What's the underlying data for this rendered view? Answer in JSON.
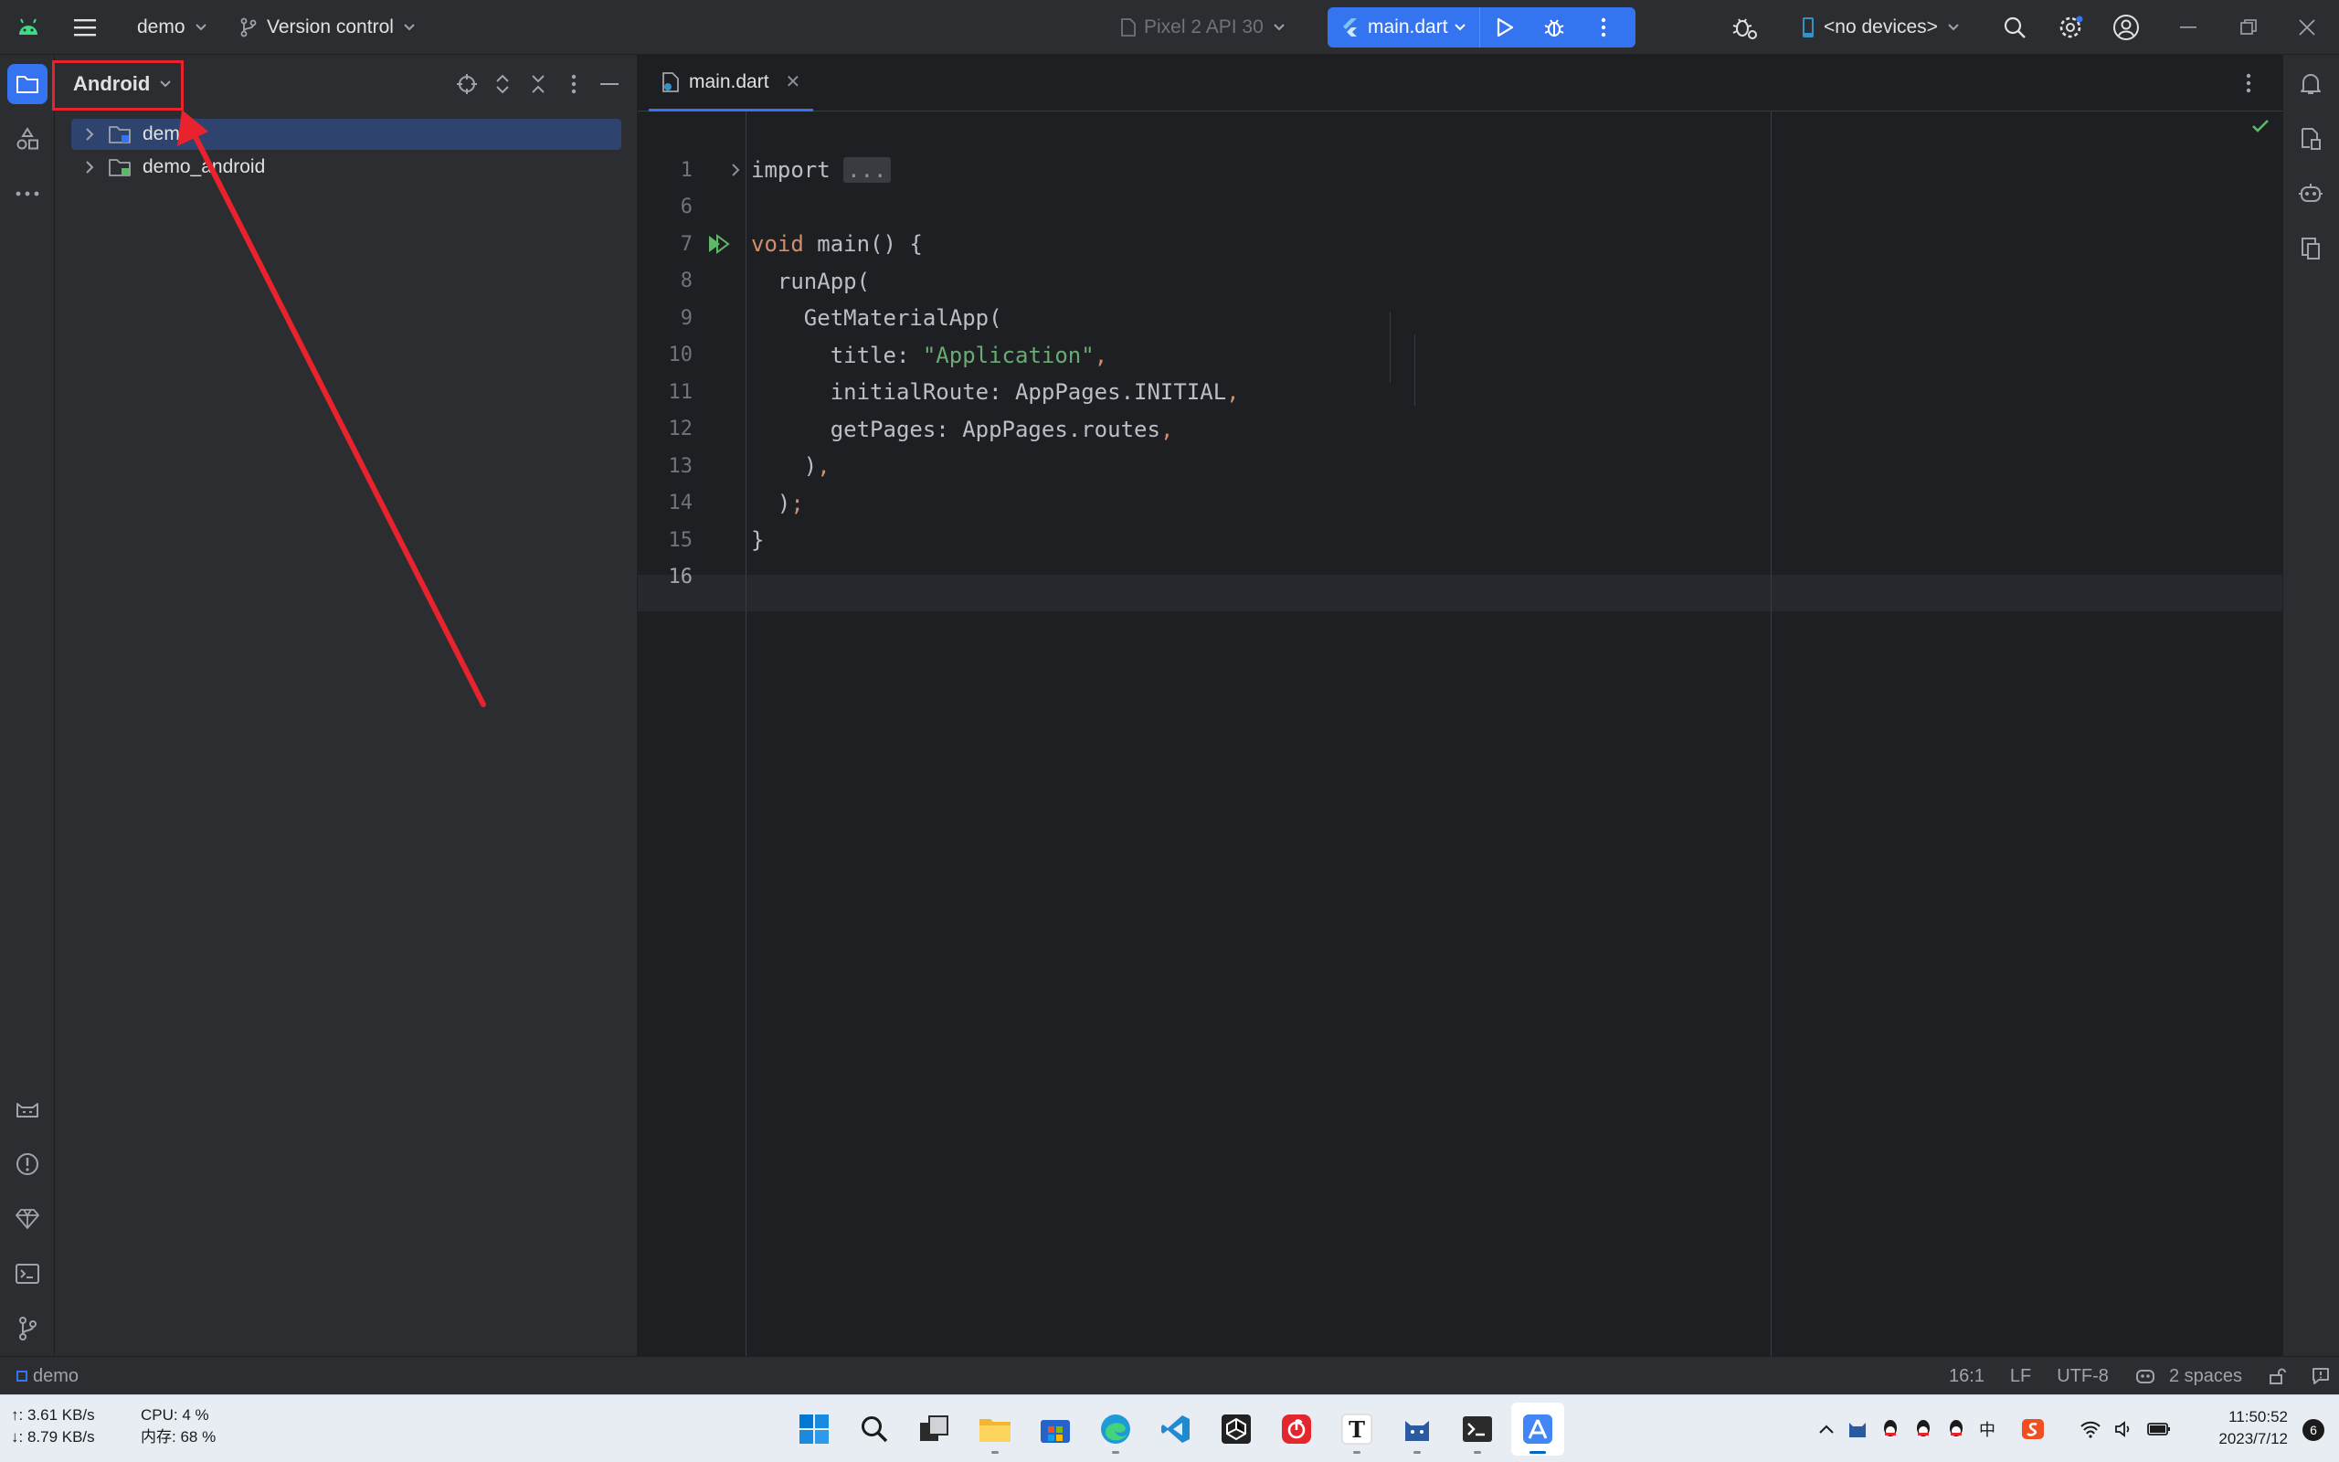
{
  "titlebar": {
    "project_name": "demo",
    "vcs_label": "Version control",
    "device_label": "Pixel 2 API 30",
    "run_config": "main.dart",
    "devices_label": "<no devices>"
  },
  "project_panel": {
    "view_mode": "Android",
    "tree": [
      {
        "label": "demo",
        "selected": true
      },
      {
        "label": "demo_android",
        "selected": false
      }
    ]
  },
  "editor": {
    "tab_label": "main.dart",
    "lines": [
      {
        "num": "1",
        "parts": [
          [
            "kw_plain",
            "import "
          ],
          [
            "fold",
            "..."
          ]
        ]
      },
      {
        "num": "6",
        "parts": []
      },
      {
        "num": "7",
        "parts": [
          [
            "kw",
            "void "
          ],
          [
            "plain",
            "main() {"
          ]
        ]
      },
      {
        "num": "8",
        "parts": [
          [
            "plain",
            "  runApp("
          ]
        ]
      },
      {
        "num": "9",
        "parts": [
          [
            "plain",
            "    GetMaterialApp("
          ]
        ]
      },
      {
        "num": "10",
        "parts": [
          [
            "plain",
            "      title: "
          ],
          [
            "str",
            "\"Application\""
          ],
          [
            "kw",
            ","
          ]
        ]
      },
      {
        "num": "11",
        "parts": [
          [
            "plain",
            "      initialRoute: AppPages.INITIAL"
          ],
          [
            "kw",
            ","
          ]
        ]
      },
      {
        "num": "12",
        "parts": [
          [
            "plain",
            "      getPages: AppPages.routes"
          ],
          [
            "kw",
            ","
          ]
        ]
      },
      {
        "num": "13",
        "parts": [
          [
            "plain",
            "    )"
          ],
          [
            "kw",
            ","
          ]
        ]
      },
      {
        "num": "14",
        "parts": [
          [
            "plain",
            "  )"
          ],
          [
            "kw",
            ";"
          ]
        ]
      },
      {
        "num": "15",
        "parts": [
          [
            "plain",
            "}"
          ]
        ]
      },
      {
        "num": "16",
        "parts": []
      }
    ]
  },
  "statusbar": {
    "breadcrumb": "demo",
    "position": "16:1",
    "line_separator": "LF",
    "encoding": "UTF-8",
    "indent": "2 spaces"
  },
  "taskbar": {
    "net_up": "↑: 3.61 KB/s",
    "net_down": "↓: 8.79 KB/s",
    "cpu": "CPU: 4 %",
    "memory": "内存: 68 %",
    "ime": "中",
    "time": "11:50:52",
    "date": "2023/7/12",
    "notifications": "6",
    "app_t_label": "T"
  },
  "colors": {
    "accent": "#3574f0",
    "annotation_red": "#e8232d",
    "string_green": "#6aab73",
    "keyword_orange": "#cf8e6d"
  }
}
